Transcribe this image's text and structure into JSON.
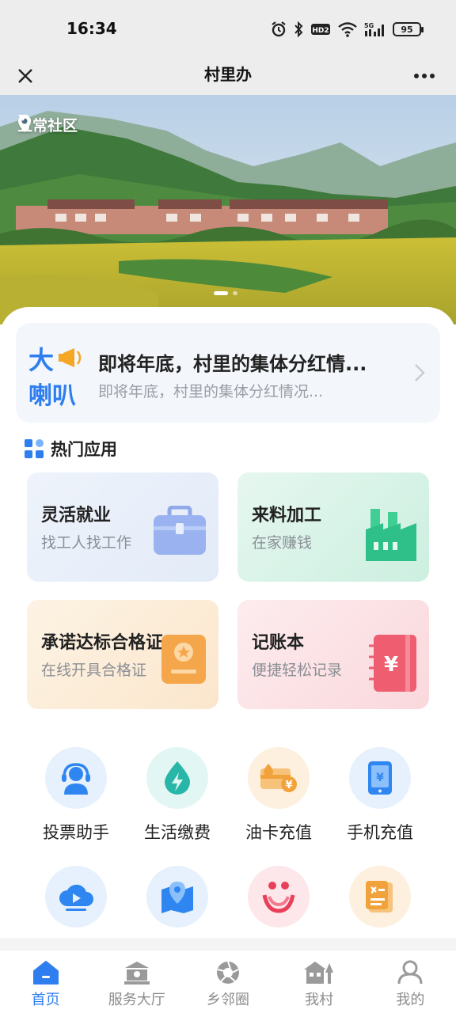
{
  "status_bar": {
    "time": "16:34",
    "network": "5G",
    "hd": "HD2",
    "battery": "95"
  },
  "title_bar": {
    "title": "村里办"
  },
  "banner": {
    "location": "五常社区"
  },
  "notice": {
    "logo_text_top": "大",
    "logo_text_bottom": "喇叭",
    "title": "即将年底，村里的集体分红情...",
    "subtitle": "即将年底，村里的集体分红情况..."
  },
  "hot_apps": {
    "title": "热门应用",
    "cards": [
      {
        "title": "灵活就业",
        "subtitle": "找工人找工作",
        "icon": "briefcase-icon"
      },
      {
        "title": "来料加工",
        "subtitle": "在家赚钱",
        "icon": "factory-icon"
      },
      {
        "title": "承诺达标合格证",
        "subtitle": "在线开具合格证",
        "icon": "certificate-icon"
      },
      {
        "title": "记账本",
        "subtitle": "便捷轻松记录",
        "icon": "ledger-icon"
      }
    ]
  },
  "services": [
    {
      "label": "投票助手",
      "icon": "headset-agent-icon",
      "color": "#2f86f0"
    },
    {
      "label": "生活缴费",
      "icon": "lightning-drop-icon",
      "color": "#27b6a8"
    },
    {
      "label": "油卡充值",
      "icon": "fuel-card-icon",
      "color": "#f2a23a"
    },
    {
      "label": "手机充值",
      "icon": "phone-recharge-icon",
      "color": "#2f86f0"
    },
    {
      "label": "",
      "icon": "cloud-play-icon",
      "color": "#2f86f0"
    },
    {
      "label": "",
      "icon": "map-pin-icon",
      "color": "#2f86f0"
    },
    {
      "label": "",
      "icon": "rings-logo-icon",
      "color": "#e8405a"
    },
    {
      "label": "",
      "icon": "party-document-icon",
      "color": "#f2a23a"
    }
  ],
  "bottom_nav": [
    {
      "label": "首页",
      "icon": "home-icon",
      "active": true
    },
    {
      "label": "服务大厅",
      "icon": "service-hall-icon",
      "active": false
    },
    {
      "label": "乡邻圈",
      "icon": "aperture-icon",
      "active": false
    },
    {
      "label": "我村",
      "icon": "village-icon",
      "active": false
    },
    {
      "label": "我的",
      "icon": "profile-icon",
      "active": false
    }
  ],
  "colors": {
    "accent": "#2f7ef0",
    "nav_inactive": "#8d8d8d",
    "status_bg": "#ededed"
  }
}
